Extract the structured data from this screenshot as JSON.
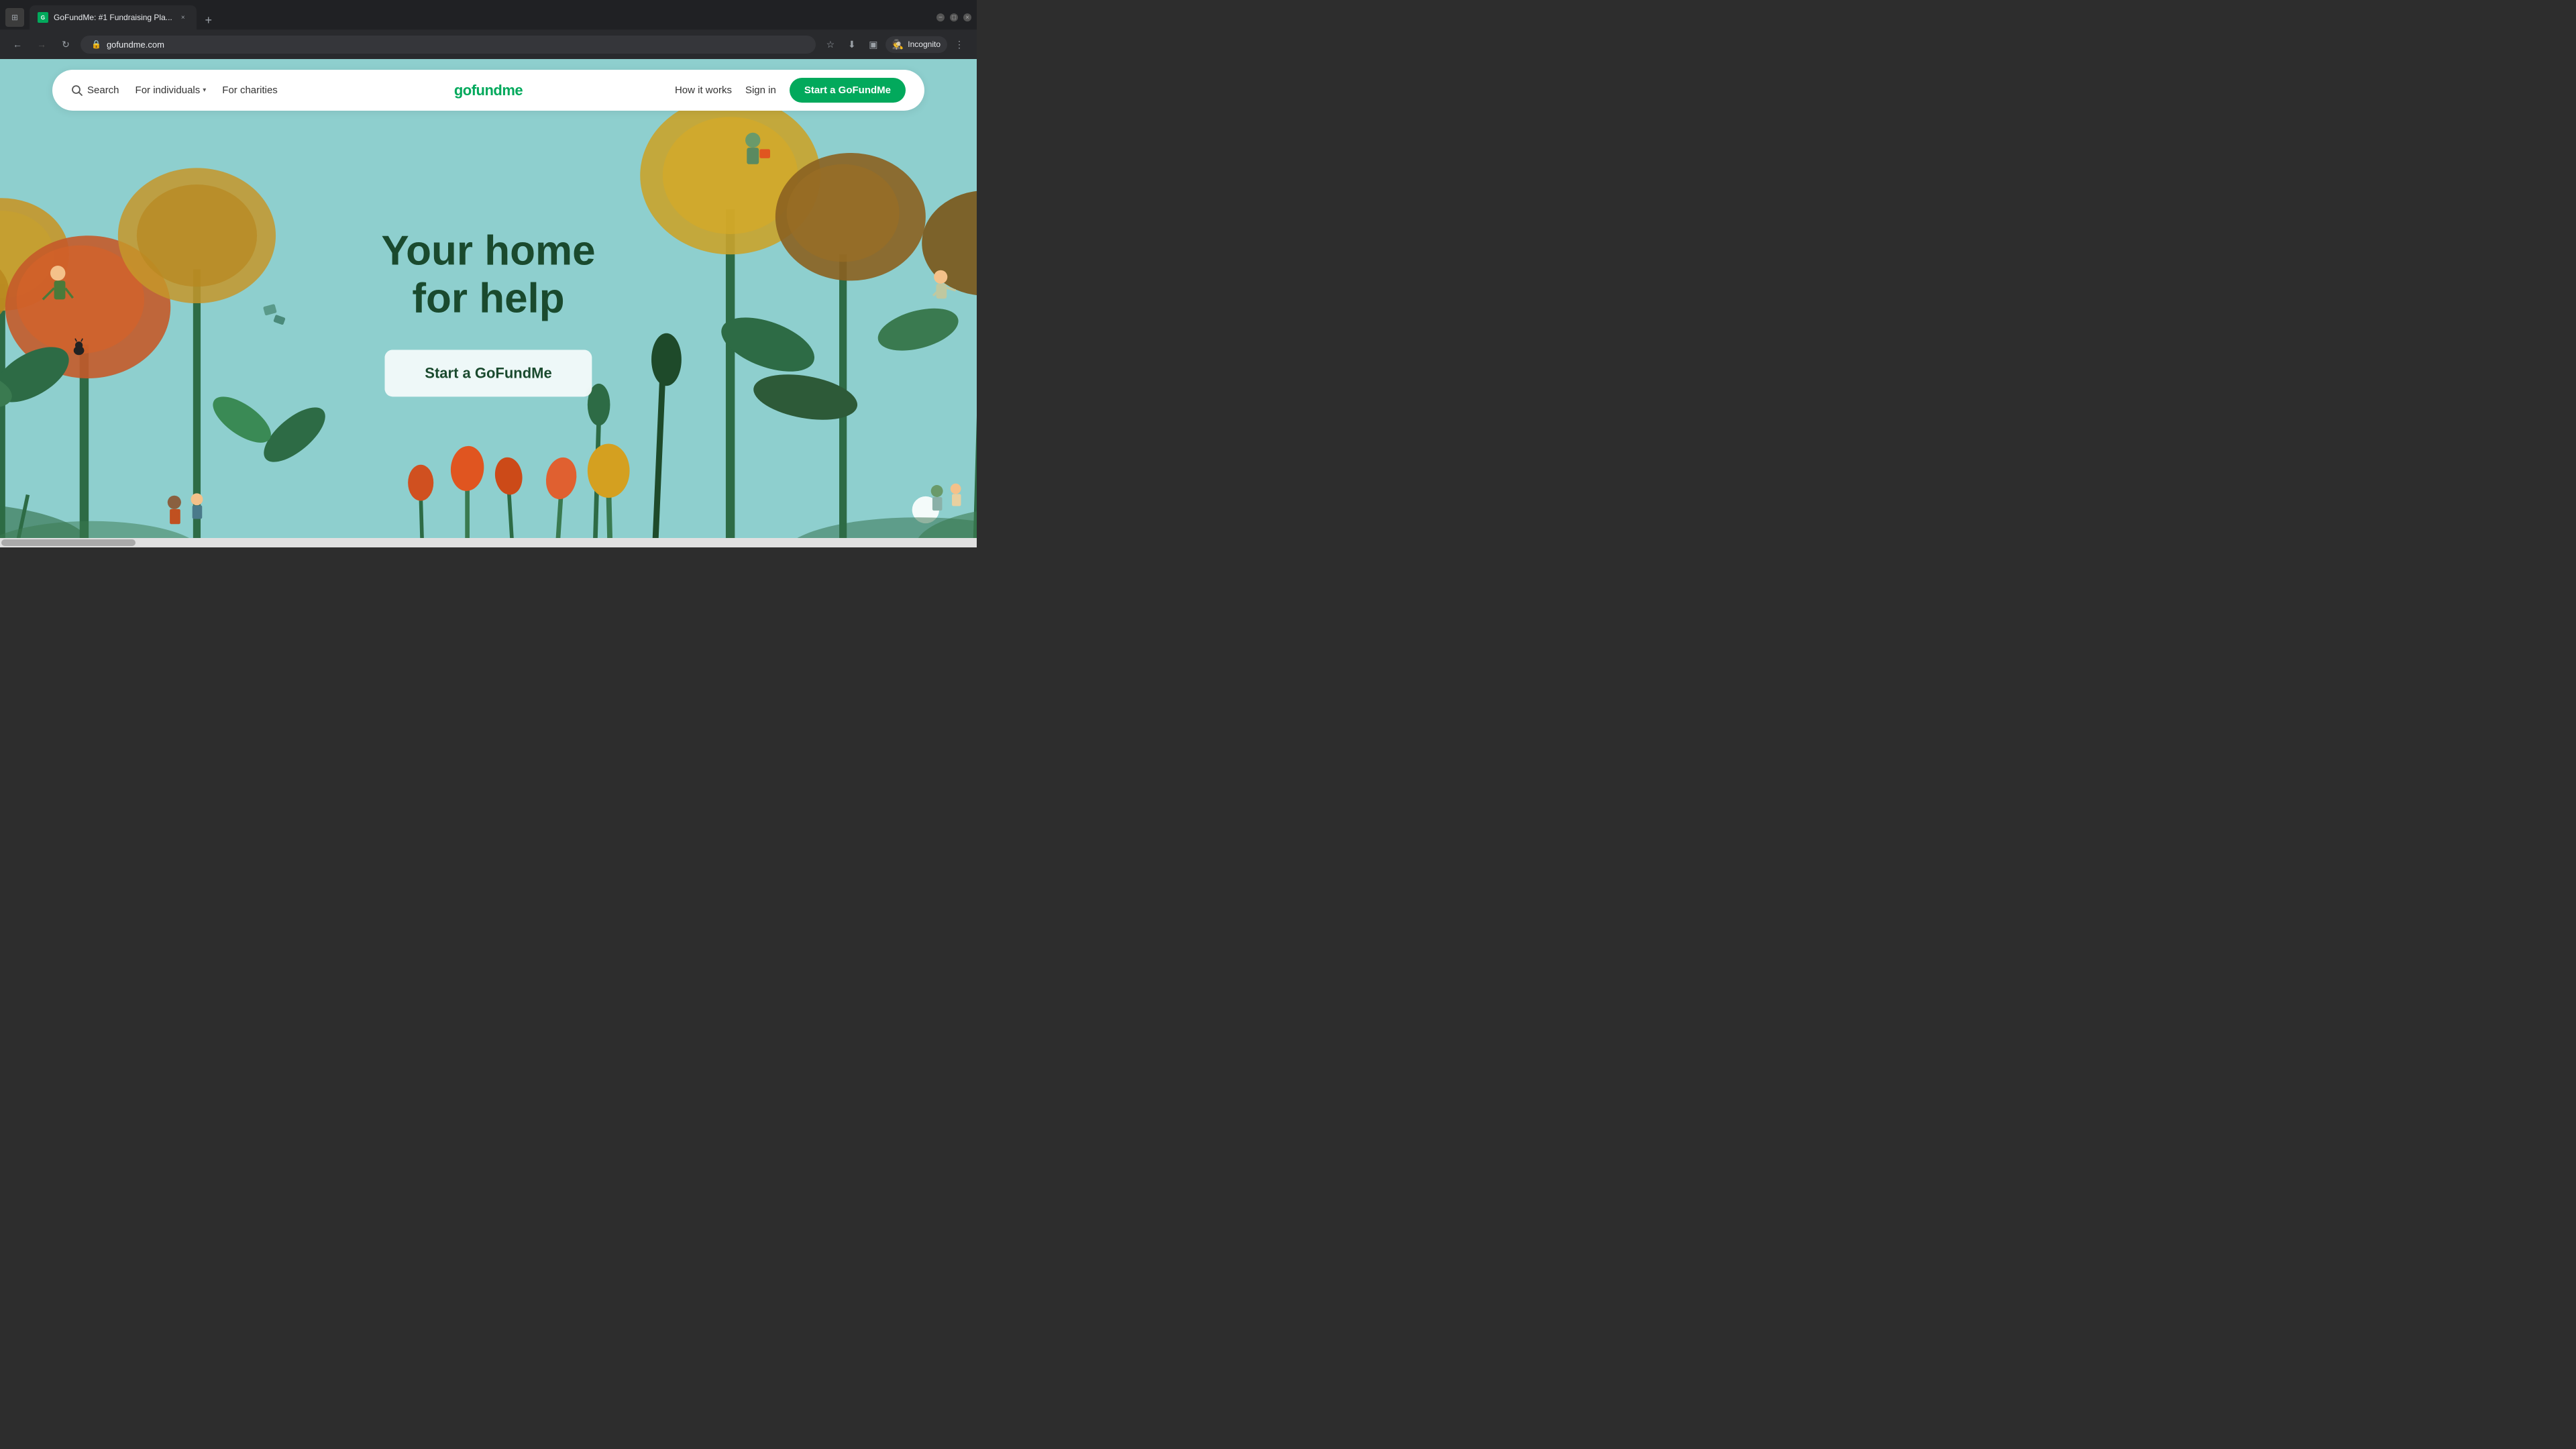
{
  "browser": {
    "tab": {
      "title": "GoFundMe: #1 Fundraising Pla...",
      "favicon_text": "G",
      "url": "gofundme.com"
    },
    "new_tab_icon": "+",
    "window_controls": {
      "minimize": "−",
      "maximize": "□",
      "close": "×"
    },
    "nav_back": "←",
    "nav_forward": "→",
    "nav_refresh": "↻",
    "incognito_label": "Incognito"
  },
  "nav": {
    "search_label": "Search",
    "for_individuals_label": "For individuals",
    "for_charities_label": "For charities",
    "how_it_works_label": "How it works",
    "sign_in_label": "Sign in",
    "start_button_label": "Start a GoFundMe",
    "logo_text": "gofundme"
  },
  "hero": {
    "title_line1": "Your home",
    "title_line2": "for help",
    "cta_label": "Start a GoFundMe"
  }
}
